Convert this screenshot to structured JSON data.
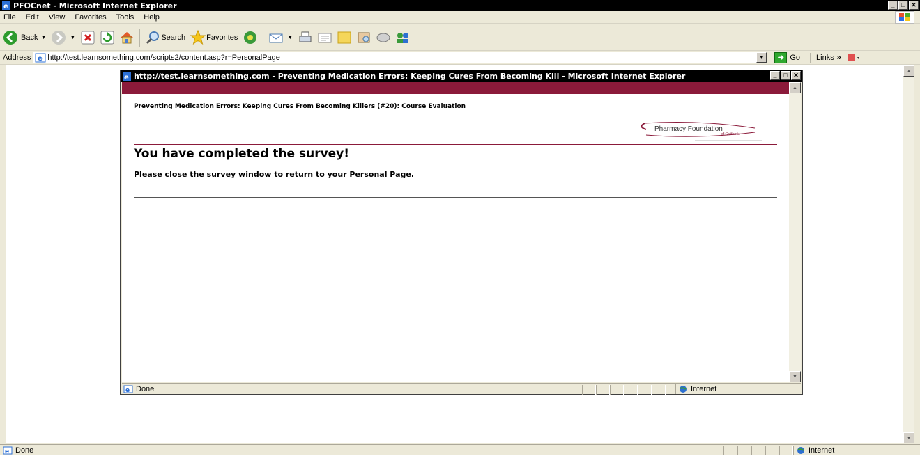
{
  "window": {
    "title": "PFOCnet - Microsoft Internet Explorer"
  },
  "menu": [
    "File",
    "Edit",
    "View",
    "Favorites",
    "Tools",
    "Help"
  ],
  "toolbar": {
    "back": "Back",
    "search": "Search",
    "favorites": "Favorites"
  },
  "address": {
    "label": "Address",
    "url": "http://test.learnsomething.com/scripts2/content.asp?r=PersonalPage",
    "go": "Go",
    "links": "Links"
  },
  "status": {
    "text": "Done",
    "zone": "Internet"
  },
  "popup": {
    "title": "http://test.learnsomething.com - Preventing Medication Errors: Keeping Cures From Becoming Kill - Microsoft Internet Explorer",
    "course_title": "Preventing Medication Errors: Keeping Cures From Becoming Killers (#20): Course Evaluation",
    "logo_name": "Pharmacy Foundation",
    "logo_sub": "of California",
    "heading": "You have completed the survey!",
    "message": "Please close the survey window to return to your Personal Page.",
    "status_text": "Done",
    "status_zone": "Internet"
  }
}
